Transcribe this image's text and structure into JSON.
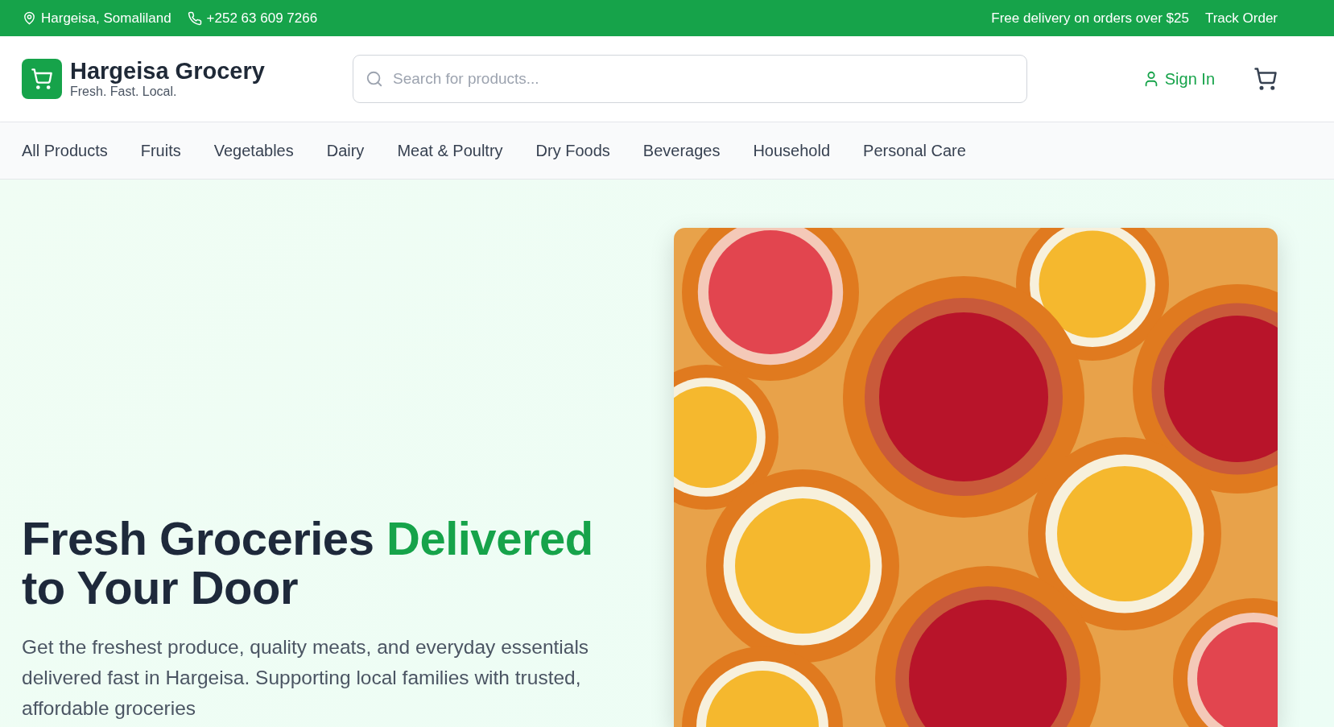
{
  "top_bar": {
    "location": "Hargeisa, Somaliland",
    "phone": "+252 63 609 7266",
    "promo": "Free delivery on orders over $25",
    "track_order": "Track Order"
  },
  "header": {
    "brand": "Hargeisa Grocery",
    "tagline": "Fresh. Fast. Local.",
    "search": {
      "placeholder": "Search for products..."
    },
    "sign_in": "Sign In"
  },
  "categories": [
    "All Products",
    "Fruits",
    "Vegetables",
    "Dairy",
    "Meat & Poultry",
    "Dry Foods",
    "Beverages",
    "Household",
    "Personal Care"
  ],
  "hero": {
    "heading_lines": [
      [
        {
          "text": "Fresh Groceries ",
          "highlight": false
        },
        {
          "text": "Delivered",
          "highlight": true
        }
      ],
      [
        {
          "text": "to Your Door",
          "highlight": false
        }
      ]
    ],
    "description": "Get the freshest produce, quality meats, and everyday essentials delivered fast in Hargeisa. Supporting local families with trusted, affordable groceries"
  }
}
